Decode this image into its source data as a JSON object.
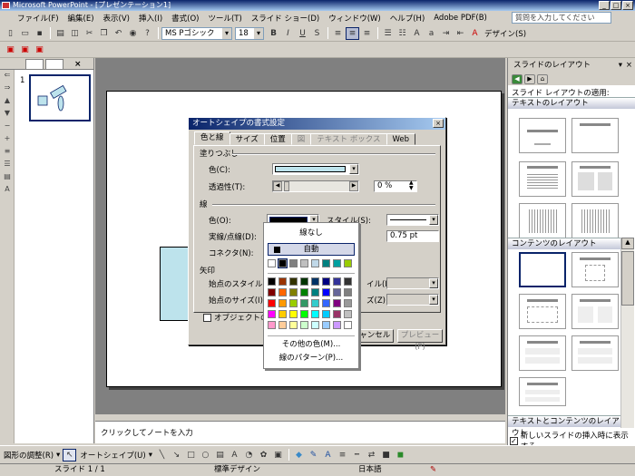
{
  "window": {
    "title": "Microsoft PowerPoint - [プレゼンテーション1]",
    "controls": [
      "_",
      "□",
      "×"
    ]
  },
  "menu": {
    "items": [
      "ファイル(F)",
      "編集(E)",
      "表示(V)",
      "挿入(I)",
      "書式(O)",
      "ツール(T)",
      "スライド ショー(D)",
      "ウィンドウ(W)",
      "ヘルプ(H)",
      "Adobe PDF(B)"
    ],
    "help_placeholder": "質問を入力してください"
  },
  "format_toolbar": {
    "font": "MS Pゴシック",
    "size": "18",
    "design_label": "デザイン(S)"
  },
  "left_pane": {
    "slide_number": "1"
  },
  "notes": {
    "placeholder": "クリックしてノートを入力"
  },
  "task_pane": {
    "title": "スライドのレイアウト",
    "apply_label": "スライド レイアウトの適用:",
    "section_text": "テキストのレイアウト",
    "section_content": "コンテンツのレイアウト",
    "section_text_content": "テキストとコンテンツのレイアウト",
    "checkbox_label": "新しいスライドの挿入時に表示する"
  },
  "dialog": {
    "title": "オートシェイプの書式設定",
    "tabs": [
      "色と線",
      "サイズ",
      "位置",
      "図",
      "テキスト ボックス",
      "Web"
    ],
    "fill_group": "塗りつぶし",
    "fill_color_label": "色(C):",
    "fill_color": "#bde3ec",
    "transparency_label": "透過性(T):",
    "transparency_value": "0 %",
    "line_group": "線",
    "line_color_label": "色(O):",
    "line_color": "#000000",
    "style_label": "スタイル(S):",
    "dash_label": "実線/点線(D):",
    "weight_value": "0.75 pt",
    "connector_label": "コネクタ(N):",
    "arrow_group": "矢印",
    "begin_style_label": "始点のスタイル(B):",
    "begin_size_label": "始点のサイズ(I):",
    "end_style_label": "イル(E):",
    "end_size_label": "ズ(Z):",
    "default_check_label": "オブジェクトの既定",
    "cancel_label": "キャンセル",
    "preview_label": "プレビュー(P)"
  },
  "palette": {
    "no_line": "線なし",
    "auto": "自動",
    "more_colors": "その他の色(M)...",
    "patterned": "線のパターン(P)...",
    "recent": [
      "#ffffff",
      "#000000",
      "#808080",
      "#bfbfbf",
      "#c0d8e8",
      "#008080",
      "#00a0a0",
      "#99cc00"
    ],
    "grid": [
      [
        "#000000",
        "#993300",
        "#333300",
        "#003300",
        "#003366",
        "#000080",
        "#333399",
        "#333333"
      ],
      [
        "#800000",
        "#ff6600",
        "#808000",
        "#008000",
        "#008080",
        "#0000ff",
        "#666699",
        "#808080"
      ],
      [
        "#ff0000",
        "#ff9900",
        "#99cc00",
        "#339966",
        "#33cccc",
        "#3366ff",
        "#800080",
        "#999999"
      ],
      [
        "#ff00ff",
        "#ffcc00",
        "#ffff00",
        "#00ff00",
        "#00ffff",
        "#00ccff",
        "#993366",
        "#c0c0c0"
      ],
      [
        "#ff99cc",
        "#ffcc99",
        "#ffff99",
        "#ccffcc",
        "#ccffff",
        "#99ccff",
        "#cc99ff",
        "#ffffff"
      ]
    ]
  },
  "drawing_toolbar": {
    "draw_label": "図形の調整(R)",
    "autoshape_label": "オートシェイプ(U)"
  },
  "status": {
    "slide": "スライド 1 / 1",
    "design": "標準デザイン",
    "language": "日本語"
  }
}
